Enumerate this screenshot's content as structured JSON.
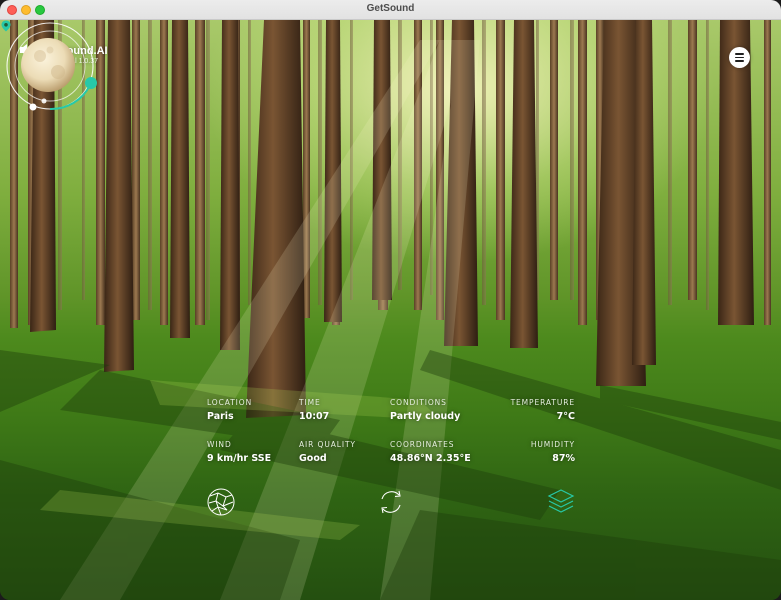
{
  "window": {
    "title": "GetSound"
  },
  "brand": {
    "name": "GetSound.AI",
    "edition": "Personal 1.0.37"
  },
  "weather": {
    "location_label": "LOCATION",
    "location_value": "Paris",
    "time_label": "TIME",
    "time_value": "10:07",
    "conditions_label": "CONDITIONS",
    "conditions_value": "Partly cloudy",
    "temperature_label": "TEMPERATURE",
    "temperature_value": "7°C",
    "wind_label": "WIND",
    "wind_value": "9 km/hr SSE",
    "air_label": "AIR QUALITY",
    "air_value": "Good",
    "coords_label": "COORDINATES",
    "coords_value": "48.86°N 2.35°E",
    "humidity_label": "HUMIDITY",
    "humidity_value": "87%"
  },
  "icons": {
    "menu": "hamburger-menu-icon",
    "orb": "moon-orb-icon",
    "location": "location-pin-icon",
    "globe": "globe-icon",
    "refresh": "refresh-icon",
    "layers": "layers-icon"
  },
  "colors": {
    "accent": "#27c9a8",
    "text": "#ffffff"
  }
}
